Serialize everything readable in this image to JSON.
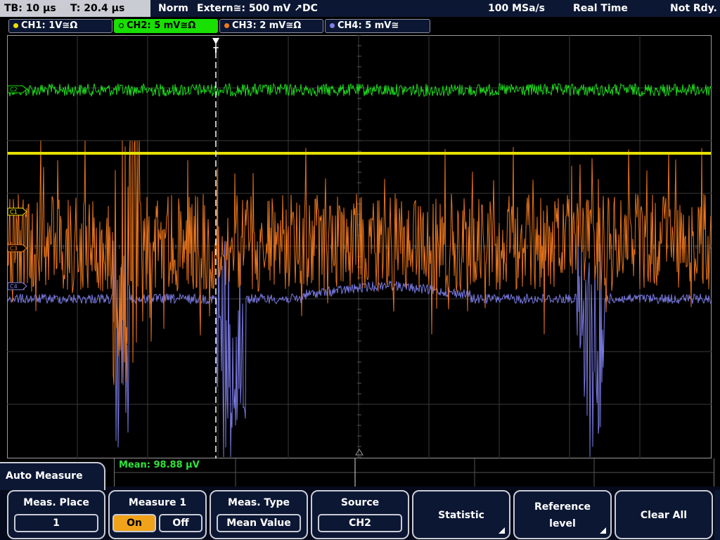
{
  "status": {
    "timebase": "TB: 10 µs",
    "trigger_time": "T: 20.4 µs",
    "trigger_mode": "Norm",
    "trigger_source": "Extern≅: 500 mV ↗DC",
    "sample_rate": "100 MSa/s",
    "acq_mode": "Real Time",
    "acq_status": "Not Rdy."
  },
  "channels": [
    {
      "label": "CH1: 1V≅Ω",
      "color": "#f0e000",
      "active": false,
      "marker": "C1"
    },
    {
      "label": "CH2: 5 mV≅Ω",
      "color": "#18e000",
      "active": true,
      "marker": "C2"
    },
    {
      "label": "CH3: 2 mV≅Ω",
      "color": "#f07a1a",
      "active": false,
      "marker": "C3"
    },
    {
      "label": "CH4: 5 mV≅",
      "color": "#8080e8",
      "active": false,
      "marker": "C4"
    }
  ],
  "trigger_marker": "T",
  "measurement": {
    "text": "Mean: 98.88 µV"
  },
  "menu": {
    "title": "Auto Measure",
    "meas_place": {
      "label": "Meas. Place",
      "value": "1"
    },
    "measure": {
      "label": "Measure 1",
      "on": "On",
      "off": "Off",
      "state": "On"
    },
    "meas_type": {
      "label": "Meas. Type",
      "value": "Mean Value"
    },
    "source": {
      "label": "Source",
      "value": "CH2"
    },
    "statistic": {
      "label": "Statistic"
    },
    "reference": {
      "label1": "Reference",
      "label2": "level"
    },
    "clear_all": {
      "label": "Clear All"
    }
  }
}
